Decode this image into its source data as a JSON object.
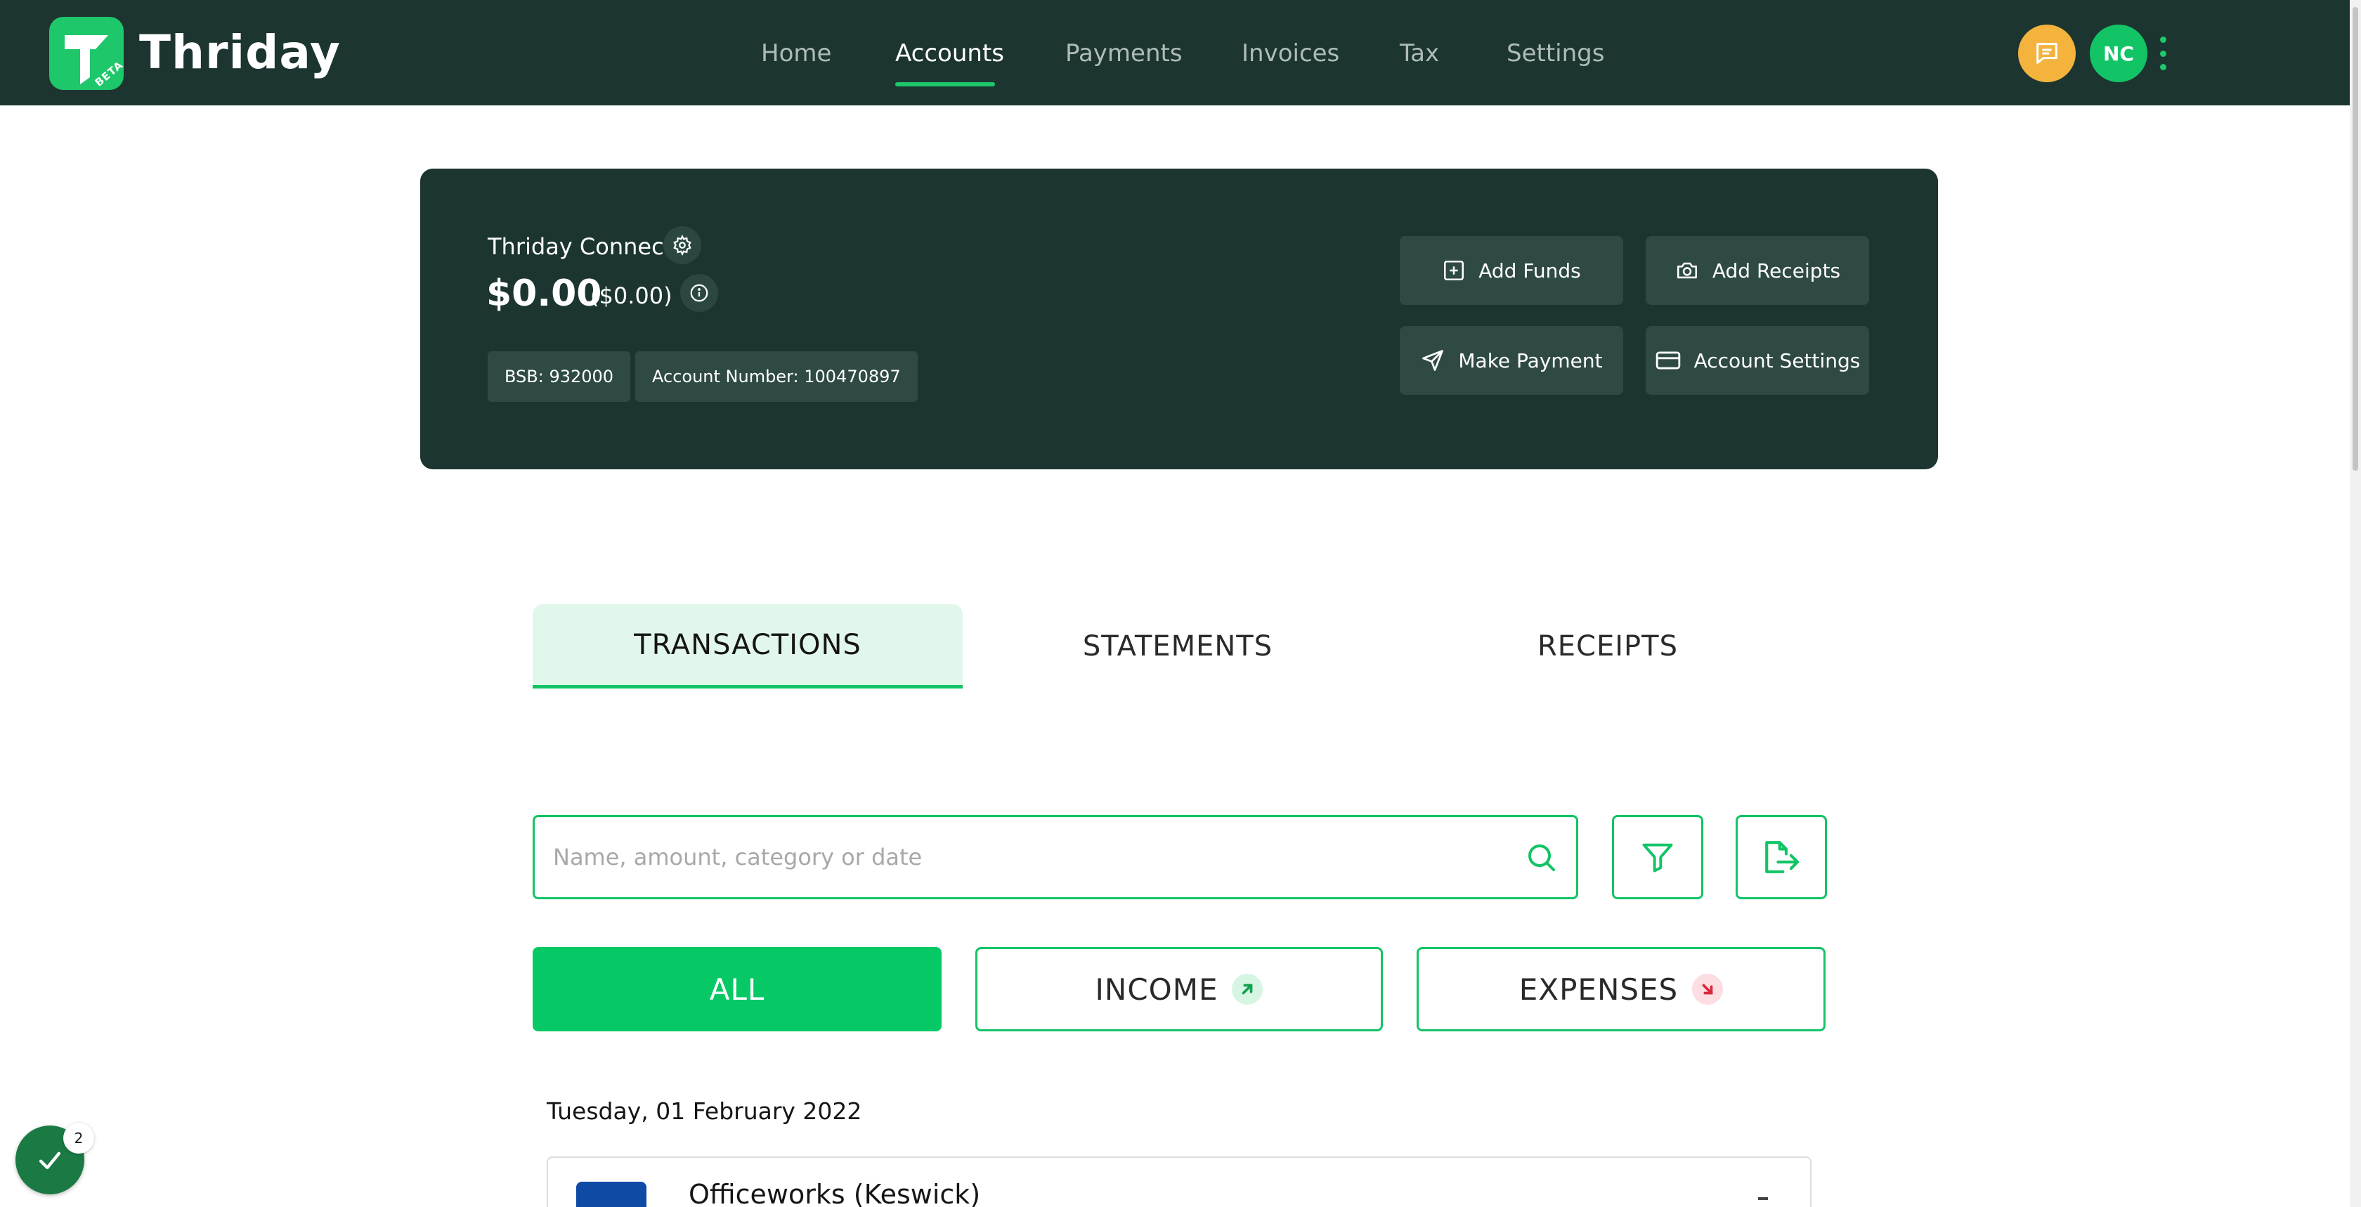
{
  "brand": {
    "name": "Thriday",
    "badge": "BETA",
    "logo_icon": "thriday-logo-icon",
    "color": "#1ec76a"
  },
  "nav": {
    "items": [
      {
        "label": "Home",
        "active": false
      },
      {
        "label": "Accounts",
        "active": true
      },
      {
        "label": "Payments",
        "active": false
      },
      {
        "label": "Invoices",
        "active": false
      },
      {
        "label": "Tax",
        "active": false
      },
      {
        "label": "Settings",
        "active": false
      }
    ],
    "chat_icon": "chat-icon",
    "avatar_initials": "NC",
    "menu_icon": "kebab-menu-icon"
  },
  "account": {
    "name": "Thriday Connect",
    "balance": "$0.00",
    "available": "($0.00)",
    "bsb": "BSB: 932000",
    "account_number": "Account Number: 100470897",
    "actions": {
      "add_funds": "Add Funds",
      "add_receipts": "Add Receipts",
      "make_payment": "Make Payment",
      "account_settings": "Account Settings"
    }
  },
  "tabs": [
    {
      "label": "TRANSACTIONS",
      "active": true
    },
    {
      "label": "STATEMENTS",
      "active": false
    },
    {
      "label": "RECEIPTS",
      "active": false
    }
  ],
  "search": {
    "placeholder": "Name, amount, category or date",
    "value": ""
  },
  "filters": {
    "all": "ALL",
    "income": "INCOME",
    "expenses": "EXPENSES",
    "selected": "ALL"
  },
  "transactions": {
    "groups": [
      {
        "date": "Tuesday, 01 February 2022",
        "items": [
          {
            "name": "Officeworks (Keswick)"
          }
        ]
      }
    ]
  },
  "tasks": {
    "count": "2"
  },
  "colors": {
    "dark": "#1c3530",
    "accent": "#12c466",
    "chat": "#f3b33d",
    "income": "#12c466",
    "expense": "#d8283c"
  }
}
